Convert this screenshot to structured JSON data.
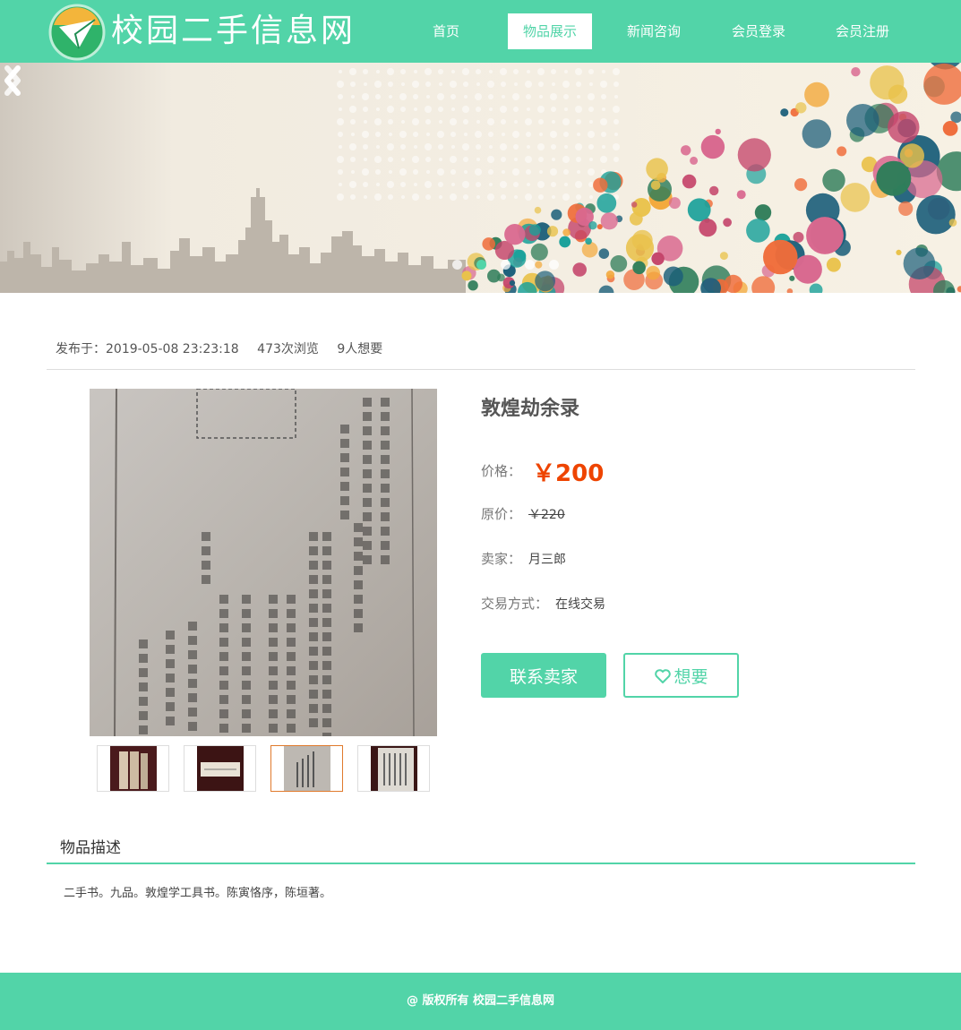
{
  "header": {
    "site_title": "校园二手信息网",
    "nav": [
      {
        "label": "首页",
        "active": false
      },
      {
        "label": "物品展示",
        "active": true
      },
      {
        "label": "新闻咨询",
        "active": false
      },
      {
        "label": "会员登录",
        "active": false
      },
      {
        "label": "会员注册",
        "active": false
      }
    ]
  },
  "banner": {
    "slide_count": 5,
    "active_slide": 2
  },
  "meta": {
    "published": "发布于：2019-05-08 23:23:18",
    "views": "473次浏览",
    "wants": "9人想要"
  },
  "gallery": {
    "thumb_count": 4,
    "active_thumb": 3
  },
  "item": {
    "title": "敦煌劫余录",
    "price_label": "价格：",
    "price": "￥200",
    "original_label": "原价：",
    "original_price": "￥220",
    "seller_label": "卖家：",
    "seller": "月三郎",
    "trade_label": "交易方式：",
    "trade": "在线交易"
  },
  "actions": {
    "contact_label": "联系卖家",
    "want_label": "想要"
  },
  "description": {
    "title": "物品描述",
    "text": "二手书。九品。敦煌学工具书。陈寅恪序，陈垣著。"
  },
  "footer": {
    "copyright": "@ 版权所有 校园二手信息网"
  },
  "colors": {
    "accent": "#52d4a8",
    "price": "#ee4400",
    "thumb_active_border": "#e07a2c"
  }
}
